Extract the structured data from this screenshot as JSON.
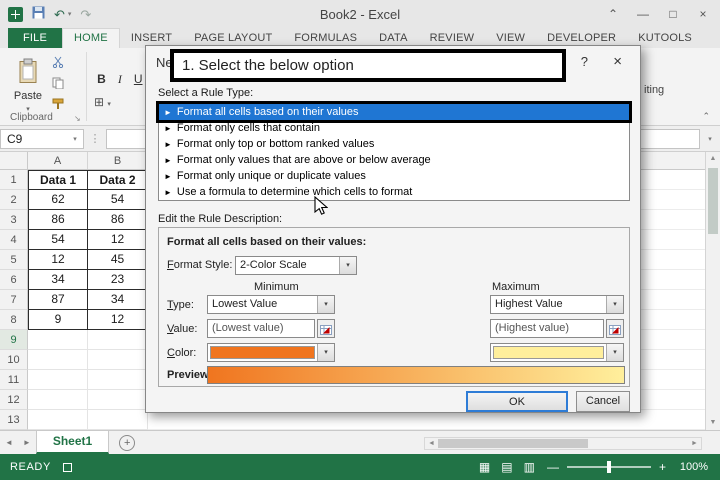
{
  "colors": {
    "accent_green": "#217346",
    "selection_blue": "#1F76D3",
    "min_color": "#F0751F",
    "max_color": "#FFEF9C"
  },
  "icons": {
    "close": "×",
    "minimize": "—",
    "restore": "□",
    "ribbon_options": "⌃",
    "help": "?",
    "dropdown": "▾",
    "rule_arrow": "►",
    "undo": "↶",
    "redo": "↷",
    "scroll_up": "▲",
    "scroll_down": "▼",
    "scroll_left": "◄",
    "scroll_right": "►",
    "view_normal": "▦",
    "view_layout": "▤",
    "view_break": "▥",
    "zoom_minus": "—",
    "zoom_plus": "+",
    "add_sheet": "+",
    "dots": "⋮",
    "bold": "B",
    "italic": "I",
    "underline": "U",
    "borders": "⊞",
    "launcher": "↘",
    "collapse": "⌃"
  },
  "title_bar": {
    "title": "Book2 - Excel"
  },
  "ribbon": {
    "tabs": [
      "FILE",
      "HOME",
      "INSERT",
      "PAGE LAYOUT",
      "FORMULAS",
      "DATA",
      "REVIEW",
      "VIEW",
      "DEVELOPER",
      "KUTOOLS"
    ],
    "paste_label": "Paste",
    "clipboard_group": "Clipboard",
    "formatting_fragment": "iting"
  },
  "formula_bar": {
    "name_box": "C9"
  },
  "grid": {
    "col_headers": [
      "A",
      "B"
    ],
    "rows": [
      {
        "n": "1",
        "a": "Data 1",
        "b": "Data 2"
      },
      {
        "n": "2",
        "a": "62",
        "b": "54"
      },
      {
        "n": "3",
        "a": "86",
        "b": "86"
      },
      {
        "n": "4",
        "a": "54",
        "b": "12"
      },
      {
        "n": "5",
        "a": "12",
        "b": "45"
      },
      {
        "n": "6",
        "a": "34",
        "b": "23"
      },
      {
        "n": "7",
        "a": "87",
        "b": "34"
      },
      {
        "n": "8",
        "a": "9",
        "b": "12"
      },
      {
        "n": "9",
        "a": "",
        "b": ""
      },
      {
        "n": "10",
        "a": "",
        "b": ""
      },
      {
        "n": "11",
        "a": "",
        "b": ""
      },
      {
        "n": "12",
        "a": "",
        "b": ""
      },
      {
        "n": "13",
        "a": "",
        "b": ""
      }
    ]
  },
  "dialog": {
    "title": "New Formatting Rule",
    "annotation": "1. Select the below option",
    "rule_type_label": "Select a Rule Type:",
    "rule_types": [
      "Format all cells based on their values",
      "Format only cells that contain",
      "Format only top or bottom ranked values",
      "Format only values that are above or below average",
      "Format only unique or duplicate values",
      "Use a formula to determine which cells to format"
    ],
    "edit_label": "Edit the Rule Description:",
    "desc_title": "Format all cells based on their values:",
    "format_style_label": "Format Style:",
    "format_style_value": "2-Color Scale",
    "minimum_label": "Minimum",
    "maximum_label": "Maximum",
    "type_label": "Type:",
    "min_type": "Lowest Value",
    "max_type": "Highest Value",
    "value_label": "Value:",
    "min_value": "(Lowest value)",
    "max_value": "(Highest value)",
    "color_label": "Color:",
    "preview_label": "Preview:",
    "ok_label": "OK",
    "cancel_label": "Cancel"
  },
  "sheet_tabs": {
    "active": "Sheet1"
  },
  "status_bar": {
    "ready": "READY",
    "zoom": "100%"
  }
}
